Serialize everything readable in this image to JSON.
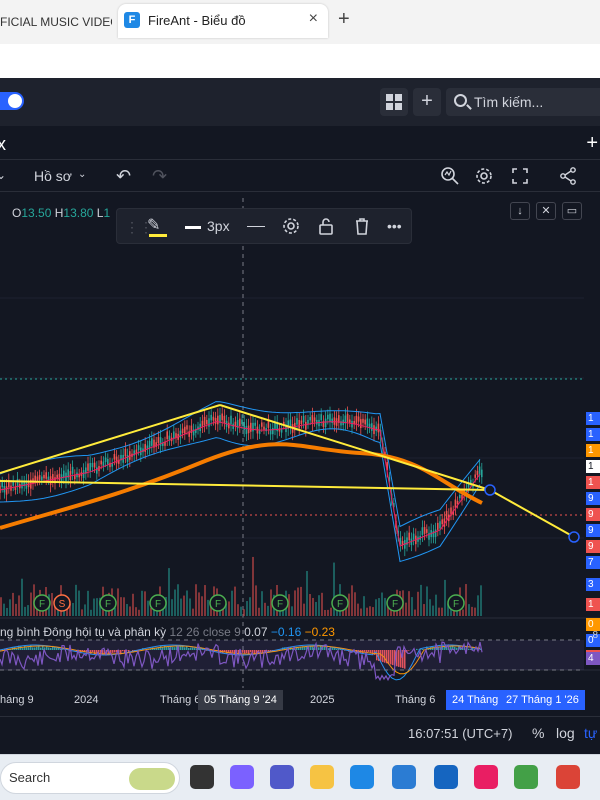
{
  "browser": {
    "tabs": [
      {
        "title": "FICIAL MUSIC VIDEO",
        "active": false
      },
      {
        "title": "FireAnt - Biểu đồ",
        "active": true
      }
    ],
    "favicon_letter": "F",
    "close_icon": "×",
    "new_tab_icon": "+"
  },
  "app": {
    "search_placeholder": "Tìm kiếm...",
    "plus_icon": "+",
    "panel_close_icon": "x",
    "panel_plus_icon": "+"
  },
  "chart_toolbar": {
    "profile_label": "Hồ sơ",
    "profile_chevron": "⌄",
    "left_chevron": "⌄",
    "undo_icon": "↶",
    "redo_icon": "↷",
    "icons": [
      "indicator-icon",
      "settings-icon",
      "fullscreen-icon",
      "share-icon"
    ]
  },
  "ohlc": {
    "o_label": "O",
    "o": "13.50",
    "h_label": "H",
    "h": "13.80",
    "l_label": "L",
    "l": "1"
  },
  "drawing_toolbar": {
    "handle": "⋮⋮",
    "pen_icon": "✎",
    "width_label": "3px",
    "line_color": "#ffeb3b"
  },
  "indicators": {
    "macd_label": "ng bình Đông hội tụ và phân kỳ",
    "macd_params": "12 26 close 9",
    "macd_value": "0.07",
    "signal_value": "−0.16",
    "hist_value": "−0.23"
  },
  "rsi": {
    "upper_tick": "8",
    "value_tag": "4"
  },
  "price_axis": {
    "ticks": [
      "2",
      "2",
      "1",
      "1",
      "1",
      "1",
      "1",
      "1",
      "9",
      "9",
      "9",
      "9",
      "7",
      "5",
      "3",
      "1",
      "0",
      "0"
    ],
    "tags": [
      {
        "text": "1",
        "color": "#2962ff"
      },
      {
        "text": "1",
        "color": "#2962ff"
      },
      {
        "text": "1",
        "color": "#ff9800"
      },
      {
        "text": "1",
        "color": "#ffffff"
      },
      {
        "text": "1",
        "color": "#ef5350"
      },
      {
        "text": "9",
        "color": "#2962ff"
      },
      {
        "text": "9",
        "color": "#ef5350"
      },
      {
        "text": "9",
        "color": "#2962ff"
      },
      {
        "text": "9",
        "color": "#ef5350"
      },
      {
        "text": "7",
        "color": "#2962ff"
      },
      {
        "text": "3",
        "color": "#2962ff"
      },
      {
        "text": "1",
        "color": "#ef5350"
      },
      {
        "text": "0",
        "color": "#ff9800"
      },
      {
        "text": "0",
        "color": "#2962ff"
      },
      {
        "text": "−",
        "color": "#ef5350"
      }
    ]
  },
  "event_markers": [
    "F",
    "S",
    "F",
    "F",
    "F",
    "F",
    "F",
    "F",
    "F"
  ],
  "time_axis": {
    "labels": [
      "háng 9",
      "2024",
      "Tháng 6",
      "2025",
      "Tháng 6"
    ],
    "crosshair_date": "05 Tháng 9 '24",
    "range_start": "24 Tháng",
    "range_end": "27 Tháng 1 '26"
  },
  "status": {
    "time": "16:07:51 (UTC+7)",
    "percent": "%",
    "log": "log",
    "auto": "tự"
  },
  "taskbar": {
    "search_label": "Search",
    "apps": [
      {
        "name": "task-view-icon",
        "color": "#333333"
      },
      {
        "name": "copilot-icon",
        "color": "#7b61ff"
      },
      {
        "name": "teams-icon",
        "color": "#5059c9"
      },
      {
        "name": "file-explorer-icon",
        "color": "#f6c343"
      },
      {
        "name": "edge-icon",
        "color": "#1e88e5"
      },
      {
        "name": "store-icon",
        "color": "#2b7cd3"
      },
      {
        "name": "app-icon",
        "color": "#1565c0"
      },
      {
        "name": "app-icon",
        "color": "#e91e63"
      },
      {
        "name": "app-icon",
        "color": "#43a047"
      },
      {
        "name": "chrome-icon",
        "color": "#db4437"
      },
      {
        "name": "app-icon",
        "color": "#2962ff"
      }
    ]
  },
  "colors": {
    "bg": "#131722",
    "trend_line": "#ffeb3b",
    "ma_orange": "#f57c00",
    "up": "#26a69a",
    "down": "#ef5350",
    "rsi": "#7e57c2"
  }
}
